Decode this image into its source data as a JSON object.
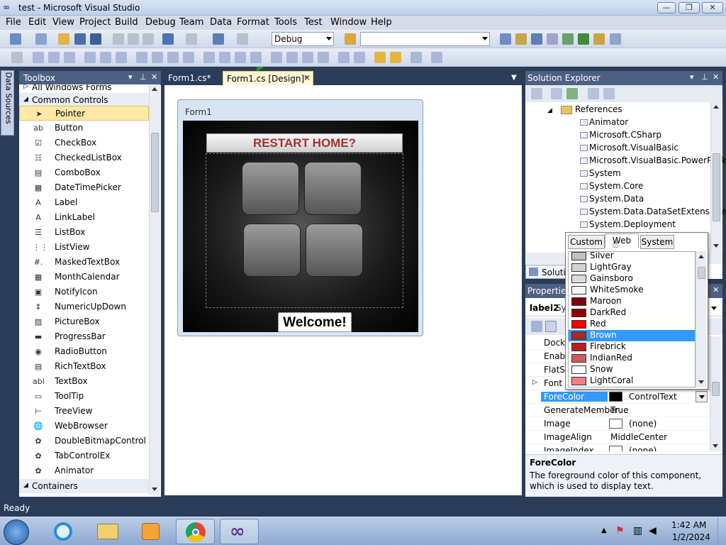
{
  "window": {
    "title": "test - Microsoft Visual Studio",
    "min_glyph": "—",
    "max_glyph": "❐",
    "close_glyph": "✕"
  },
  "menu": [
    "File",
    "Edit",
    "View",
    "Project",
    "Build",
    "Debug",
    "Team",
    "Data",
    "Format",
    "Tools",
    "Test",
    "Window",
    "Help"
  ],
  "toolbar": {
    "config": "Debug",
    "platform": ""
  },
  "side_tab": "Data Sources",
  "toolbox": {
    "title": "Toolbox",
    "top_category": "All Windows Forms",
    "common_category": "Common Controls",
    "containers_category": "Containers",
    "items": [
      {
        "label": "Pointer",
        "icon": "pointer-icon"
      },
      {
        "label": "Button",
        "icon": "button-icon"
      },
      {
        "label": "CheckBox",
        "icon": "checkbox-icon"
      },
      {
        "label": "CheckedListBox",
        "icon": "checkedlistbox-icon"
      },
      {
        "label": "ComboBox",
        "icon": "combobox-icon"
      },
      {
        "label": "DateTimePicker",
        "icon": "datetimepicker-icon"
      },
      {
        "label": "Label",
        "icon": "label-icon"
      },
      {
        "label": "LinkLabel",
        "icon": "linklabel-icon"
      },
      {
        "label": "ListBox",
        "icon": "listbox-icon"
      },
      {
        "label": "ListView",
        "icon": "listview-icon"
      },
      {
        "label": "MaskedTextBox",
        "icon": "maskedtextbox-icon"
      },
      {
        "label": "MonthCalendar",
        "icon": "monthcalendar-icon"
      },
      {
        "label": "NotifyIcon",
        "icon": "notifyicon-icon"
      },
      {
        "label": "NumericUpDown",
        "icon": "numericupdown-icon"
      },
      {
        "label": "PictureBox",
        "icon": "picturebox-icon"
      },
      {
        "label": "ProgressBar",
        "icon": "progressbar-icon"
      },
      {
        "label": "RadioButton",
        "icon": "radiobutton-icon"
      },
      {
        "label": "RichTextBox",
        "icon": "richtextbox-icon"
      },
      {
        "label": "TextBox",
        "icon": "textbox-icon"
      },
      {
        "label": "ToolTip",
        "icon": "tooltip-icon"
      },
      {
        "label": "TreeView",
        "icon": "treeview-icon"
      },
      {
        "label": "WebBrowser",
        "icon": "webbrowser-icon"
      },
      {
        "label": "DoubleBitmapControl",
        "icon": "gear-icon"
      },
      {
        "label": "TabControlEx",
        "icon": "gear-icon"
      },
      {
        "label": "Animator",
        "icon": "gear-icon"
      }
    ],
    "item_glyphs": [
      "➤",
      "ab",
      "☑",
      "☷",
      "▤",
      "▦",
      "A",
      "A",
      "☰",
      "⋮⋮",
      "#.",
      "▦",
      "▣",
      "⇕",
      "▨",
      "▬",
      "◉",
      "▤",
      "abl",
      "▭",
      "⊢",
      "🌐",
      "✿",
      "✿",
      "✿"
    ]
  },
  "tabs": [
    {
      "label": "Form1.cs*"
    },
    {
      "label": "Form1.cs [Design]*"
    }
  ],
  "form": {
    "title": "Form1",
    "header_text": "RESTART HOME?",
    "welcome_text": "Welcome!"
  },
  "solution": {
    "title": "Solution Explorer",
    "references_label": "References",
    "items": [
      "Animator",
      "Microsoft.CSharp",
      "Microsoft.VisualBasic",
      "Microsoft.VisualBasic.PowerPacks",
      "System",
      "System.Core",
      "System.Data",
      "System.Data.DataSetExtensions",
      "System.Deployment"
    ],
    "bottom_tab": "Solution"
  },
  "properties": {
    "title": "Properties",
    "object_name": "label2",
    "object_type": "System.Windows.Forms.Label",
    "rows": [
      {
        "name": "Dock",
        "value": ""
      },
      {
        "name": "Enabled",
        "value": ""
      },
      {
        "name": "FlatStyle",
        "value": ""
      },
      {
        "name": "Font",
        "value": ""
      },
      {
        "name": "ForeColor",
        "value": "ControlText",
        "swatch": "#000000"
      },
      {
        "name": "GenerateMember",
        "value": "True"
      },
      {
        "name": "Image",
        "value": "(none)",
        "swatch": "#ffffff"
      },
      {
        "name": "ImageAlign",
        "value": "MiddleCenter"
      },
      {
        "name": "ImageIndex",
        "value": "(none)",
        "swatch": "#ffffff"
      }
    ],
    "desc_title": "ForeColor",
    "desc_text": "The foreground color of this component, which is used to display text."
  },
  "color_popup": {
    "tabs": [
      "Custom",
      "Web",
      "System"
    ],
    "active_tab": "Web",
    "selected": "Brown",
    "colors": [
      {
        "name": "Silver",
        "hex": "#c0c0c0"
      },
      {
        "name": "LightGray",
        "hex": "#d3d3d3"
      },
      {
        "name": "Gainsboro",
        "hex": "#dcdcdc"
      },
      {
        "name": "WhiteSmoke",
        "hex": "#f5f5f5"
      },
      {
        "name": "Maroon",
        "hex": "#800000"
      },
      {
        "name": "DarkRed",
        "hex": "#8b0000"
      },
      {
        "name": "Red",
        "hex": "#ff0000"
      },
      {
        "name": "Brown",
        "hex": "#a52a2a"
      },
      {
        "name": "Firebrick",
        "hex": "#b22222"
      },
      {
        "name": "IndianRed",
        "hex": "#cd5c5c"
      },
      {
        "name": "Snow",
        "hex": "#fffafa"
      },
      {
        "name": "LightCoral",
        "hex": "#f08080"
      }
    ]
  },
  "status": {
    "text": "Ready"
  },
  "clock": {
    "time": "1:42 AM",
    "date": "1/2/2024"
  }
}
